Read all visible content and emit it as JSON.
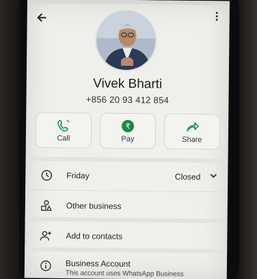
{
  "contact": {
    "name": "Vivek Bharti",
    "phone": "+856 20 93 412 854"
  },
  "actions": [
    {
      "label": "Call",
      "icon": "phone-icon"
    },
    {
      "label": "Pay",
      "icon": "rupee-icon"
    },
    {
      "label": "Share",
      "icon": "share-icon"
    }
  ],
  "hours": {
    "day": "Friday",
    "status": "Closed"
  },
  "rows": {
    "other_business": "Other business",
    "add_contacts": "Add to contacts",
    "business_account": "Business Account",
    "business_account_sub": "This account uses WhatsApp Business"
  },
  "colors": {
    "accent": "#1a8f4a",
    "pay_badge": "#178a44"
  }
}
